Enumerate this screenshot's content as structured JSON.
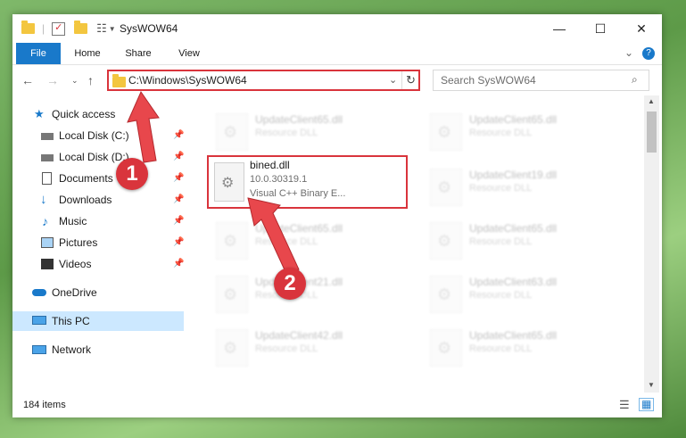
{
  "window": {
    "title": "SysWOW64",
    "controls": {
      "minimize": "—",
      "maximize": "☐",
      "close": "✕"
    }
  },
  "ribbon": {
    "tabs": [
      "File",
      "Home",
      "Share",
      "View"
    ],
    "collapse": "⌄",
    "help": "?"
  },
  "address": {
    "path": "C:\\Windows\\SysWOW64",
    "search_placeholder": "Search SysWOW64",
    "icons": [
      "back-arrow-icon",
      "forward-arrow-icon",
      "recent-chevron-icon",
      "up-arrow-icon",
      "refresh-icon",
      "search-icon"
    ]
  },
  "nav_pane": {
    "items": [
      {
        "label": "Quick access",
        "icon": "star-icon",
        "pinned": false
      },
      {
        "label": "Local Disk (C:)",
        "icon": "drive-icon",
        "pinned": true
      },
      {
        "label": "Local Disk (D:)",
        "icon": "drive-icon",
        "pinned": true
      },
      {
        "label": "Documents",
        "icon": "document-icon",
        "pinned": true
      },
      {
        "label": "Downloads",
        "icon": "download-icon",
        "pinned": true
      },
      {
        "label": "Music",
        "icon": "music-icon",
        "pinned": true
      },
      {
        "label": "Pictures",
        "icon": "pictures-icon",
        "pinned": true
      },
      {
        "label": "Videos",
        "icon": "video-icon",
        "pinned": true
      },
      {
        "label": "OneDrive",
        "icon": "cloud-icon",
        "pinned": false
      },
      {
        "label": "This PC",
        "icon": "computer-icon",
        "pinned": false,
        "selected": true
      },
      {
        "label": "Network",
        "icon": "network-icon",
        "pinned": false
      }
    ]
  },
  "files": {
    "highlighted": {
      "name": "bined.dll",
      "version": "10.0.30319.1",
      "type": "Visual C++ Binary E..."
    },
    "left_column": [
      {
        "name": "UpdateClient65.dll",
        "type": "Resource DLL"
      },
      {
        "name": "UpdateClient65.dll",
        "type": "Resource DLL"
      },
      {
        "name": "UpdateClient21.dll",
        "type": "Resource DLL"
      },
      {
        "name": "UpdateClient42.dll",
        "type": "Resource DLL"
      }
    ],
    "right_column": [
      {
        "name": "UpdateClient65.dll",
        "type": "Resource DLL"
      },
      {
        "name": "UpdateClient19.dll",
        "type": "Resource DLL"
      },
      {
        "name": "UpdateClient65.dll",
        "type": "Resource DLL"
      },
      {
        "name": "UpdateClient63.dll",
        "type": "Resource DLL"
      },
      {
        "name": "UpdateClient65.dll",
        "type": "Resource DLL"
      }
    ]
  },
  "status": {
    "count": "184 items"
  },
  "callouts": [
    "1",
    "2"
  ],
  "colors": {
    "accent": "#1979ca",
    "callout": "#d9343c",
    "selected": "#cce8ff",
    "folder": "#f3c63f"
  }
}
